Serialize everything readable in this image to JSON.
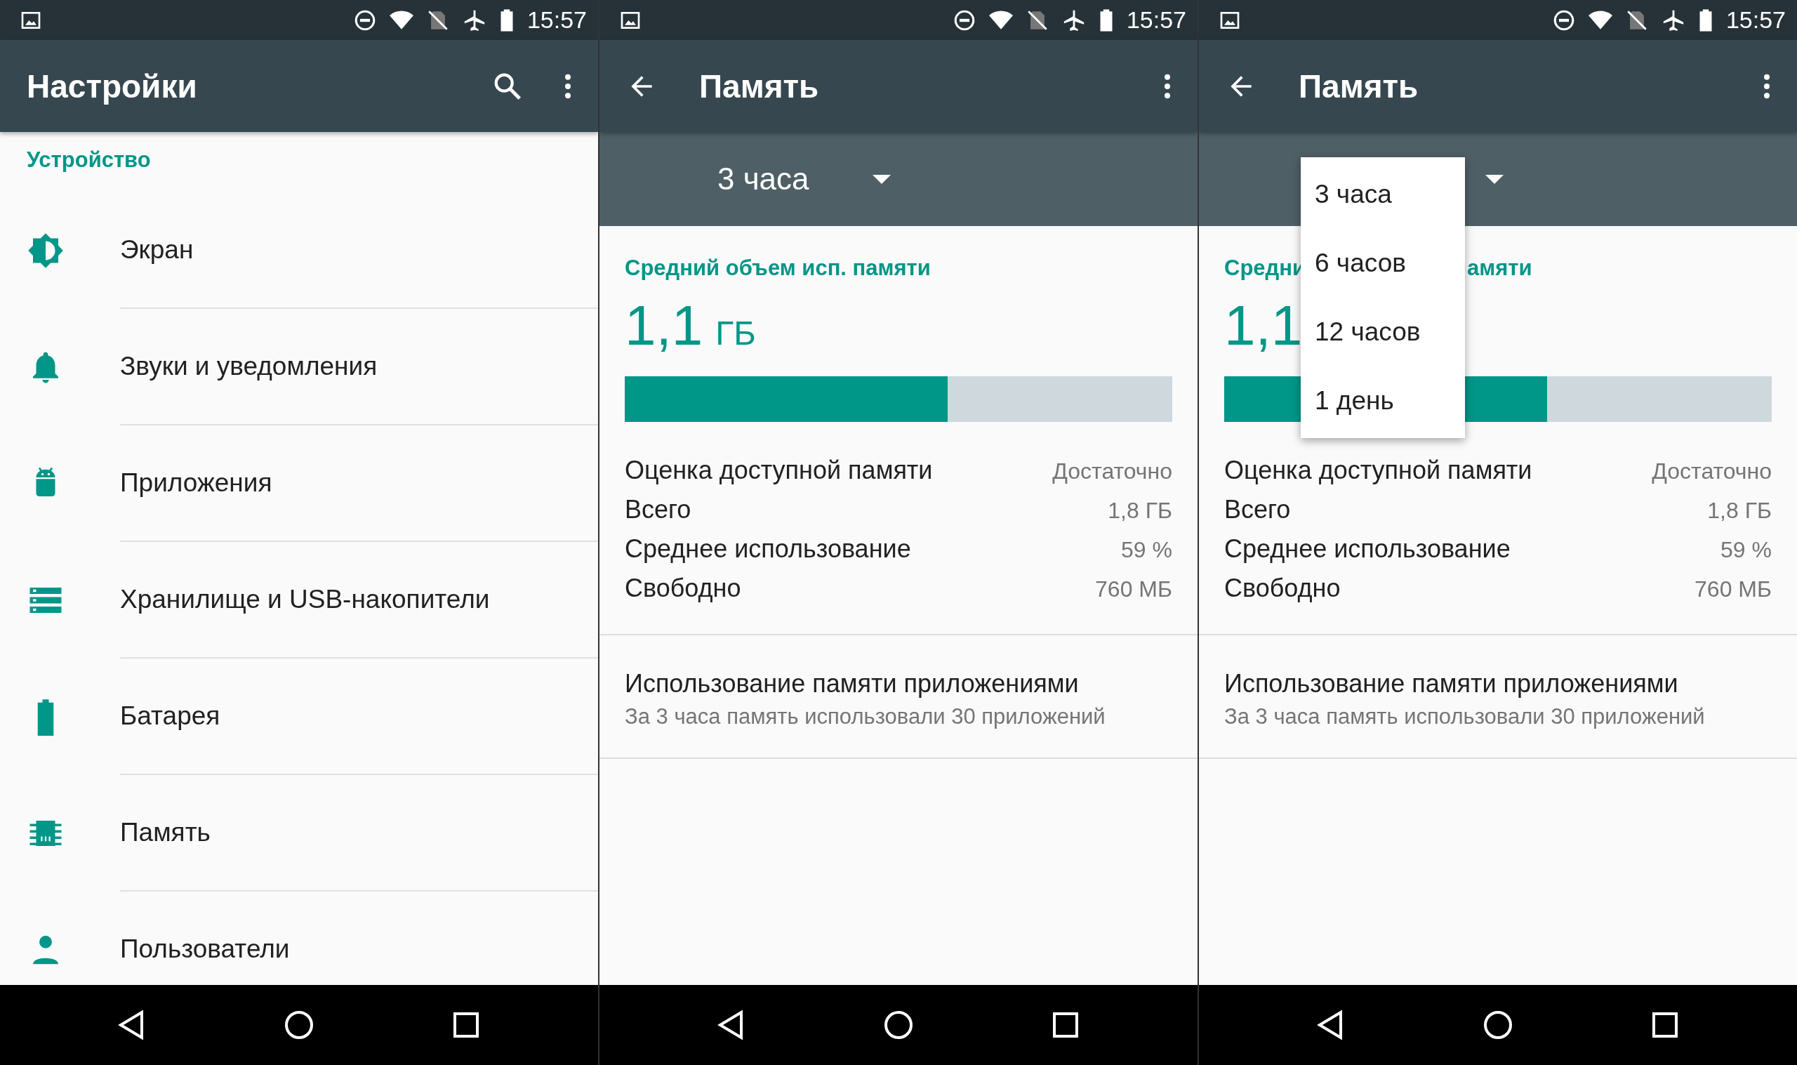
{
  "panels": [
    {
      "kind": "settings",
      "time": "15:57",
      "title": "Настройки",
      "section": "Устройство",
      "items": [
        {
          "label": "Экран"
        },
        {
          "label": "Звуки и уведомления"
        },
        {
          "label": "Приложения"
        },
        {
          "label": "Хранилище и USB-накопители"
        },
        {
          "label": "Батарея"
        },
        {
          "label": "Память"
        },
        {
          "label": "Пользователи"
        }
      ]
    },
    {
      "kind": "memory",
      "time": "15:57",
      "title": "Память",
      "period": "3 часа",
      "heading": [
        "Средний объем исп. памяти"
      ],
      "amount": "1,1",
      "unit": "ГБ",
      "level": 0.59,
      "rows": [
        {
          "label": "Оценка доступной памяти",
          "value": "Достаточно"
        },
        {
          "label": "Всего",
          "value": "1,8 ГБ"
        },
        {
          "label": "Среднее использование",
          "value": "59 %"
        },
        {
          "label": "Свободно",
          "value": "760 МБ"
        }
      ],
      "apps": {
        "title": "Использование памяти приложениями",
        "subtitle": "За 3 часа память использовали 30 приложений"
      }
    },
    {
      "kind": "memory",
      "time": "15:57",
      "title": "Память",
      "heading": [
        "Средни",
        "амяти"
      ],
      "amount": "1,1",
      "level": 0.59,
      "rows": [
        {
          "label": "Оценка доступной памяти",
          "value": "Достаточно"
        },
        {
          "label": "Всего",
          "value": "1,8 ГБ"
        },
        {
          "label": "Среднее использование",
          "value": "59 %"
        },
        {
          "label": "Свободно",
          "value": "760 МБ"
        }
      ],
      "apps": {
        "title": "Использование памяти приложениями",
        "subtitle": "За 3 часа память использовали 30 приложений"
      },
      "menu": [
        {
          "label": "3 часа"
        },
        {
          "label": "6 часов"
        },
        {
          "label": "12 часов"
        },
        {
          "label": "1 день"
        }
      ]
    }
  ]
}
